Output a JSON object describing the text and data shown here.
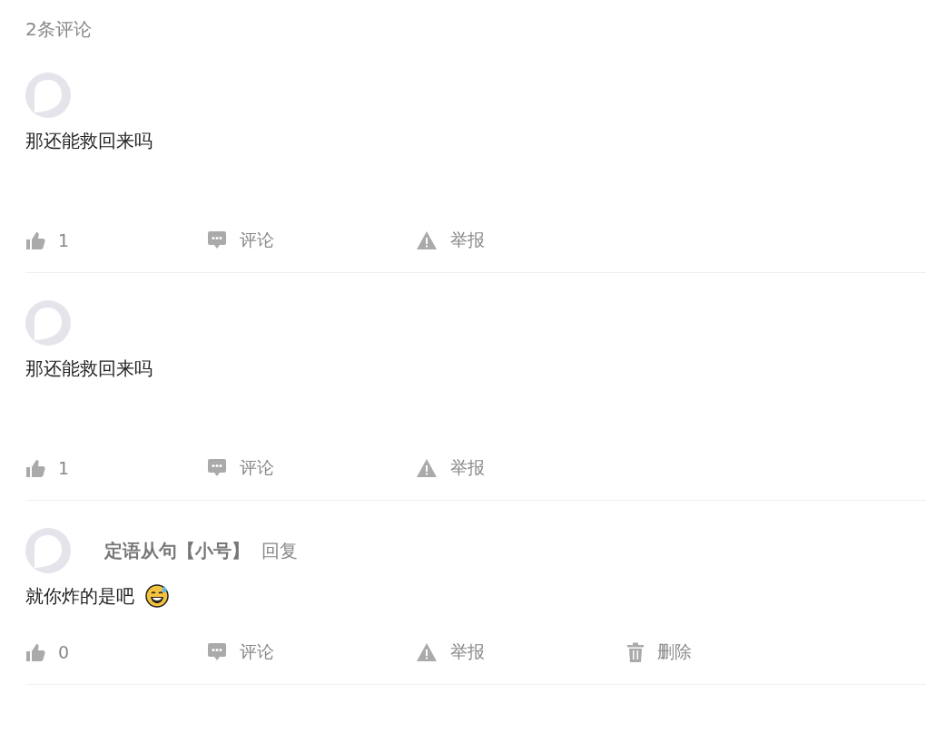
{
  "heading": "2条评论",
  "comments": [
    {
      "text": "那还能救回来吗",
      "actions": [
        {
          "kind": "like",
          "label": "1"
        },
        {
          "kind": "comment",
          "label": "评论"
        },
        {
          "kind": "report",
          "label": "举报"
        }
      ]
    },
    {
      "text": "那还能救回来吗",
      "actions": [
        {
          "kind": "like",
          "label": "1"
        },
        {
          "kind": "comment",
          "label": "评论"
        },
        {
          "kind": "report",
          "label": "举报"
        }
      ]
    },
    {
      "author": "定语从句【小号】",
      "reply_label": "回复",
      "text": "就你炸的是吧",
      "emoji": true,
      "actions": [
        {
          "kind": "like",
          "label": "0"
        },
        {
          "kind": "comment",
          "label": "评论"
        },
        {
          "kind": "report",
          "label": "举报"
        },
        {
          "kind": "delete",
          "label": "删除"
        }
      ]
    }
  ]
}
